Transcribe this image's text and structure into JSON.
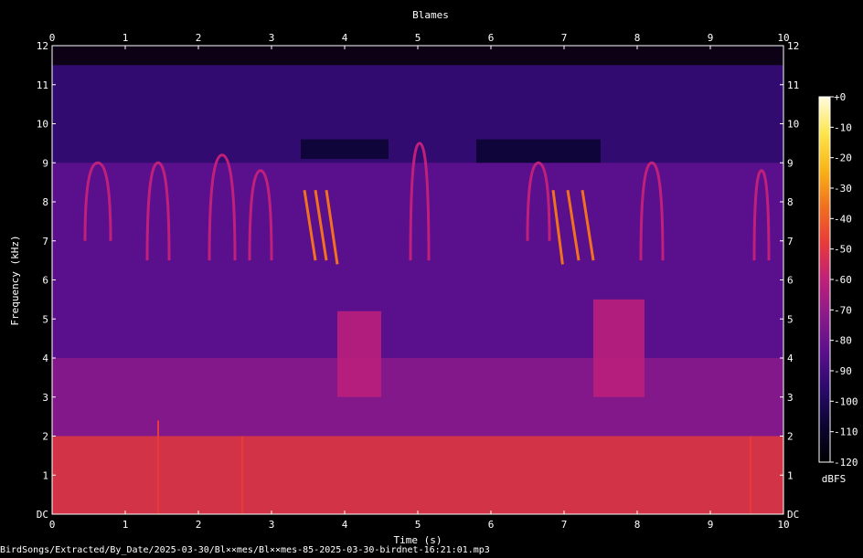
{
  "chart_data": {
    "type": "heatmap",
    "title": "Blames",
    "xlabel": "Time (s)",
    "ylabel": "Frequency (kHz)",
    "xlim": [
      0,
      10
    ],
    "ylim": [
      0,
      12
    ],
    "x_ticks": [
      "0",
      "1",
      "2",
      "3",
      "4",
      "5",
      "6",
      "7",
      "8",
      "9",
      "10"
    ],
    "y_ticks": [
      "DC",
      "1",
      "2",
      "3",
      "4",
      "5",
      "6",
      "7",
      "8",
      "9",
      "10",
      "11",
      "12"
    ],
    "colorbar": {
      "label": "dBFS",
      "range": [
        -120,
        0
      ],
      "ticks": [
        "+0",
        "-10",
        "-20",
        "-30",
        "-40",
        "-50",
        "-60",
        "-70",
        "-80",
        "-90",
        "-100",
        "-110",
        "-120"
      ],
      "colors": [
        "#000000",
        "#0b0530",
        "#2a0a6b",
        "#5a0f8c",
        "#8a1a8a",
        "#c0207a",
        "#e83a3a",
        "#f2701e",
        "#f9b417",
        "#fde64c",
        "#fffbe0"
      ]
    },
    "features": [
      {
        "type": "band",
        "t": [
          0.0,
          10.0
        ],
        "f": [
          0.0,
          2.0
        ],
        "db": -45
      },
      {
        "type": "band",
        "t": [
          0.0,
          10.0
        ],
        "f": [
          2.0,
          4.0
        ],
        "db": -70
      },
      {
        "type": "band",
        "t": [
          0.0,
          10.0
        ],
        "f": [
          4.0,
          9.0
        ],
        "db": -85
      },
      {
        "type": "band",
        "t": [
          0.0,
          10.0
        ],
        "f": [
          9.0,
          11.5
        ],
        "db": -95
      },
      {
        "type": "band",
        "t": [
          0.0,
          10.0
        ],
        "f": [
          11.5,
          12.0
        ],
        "db": -115
      },
      {
        "type": "band",
        "t": [
          3.4,
          4.6
        ],
        "f": [
          9.1,
          9.6
        ],
        "db": -112
      },
      {
        "type": "band",
        "t": [
          5.8,
          7.5
        ],
        "f": [
          9.0,
          9.6
        ],
        "db": -112
      },
      {
        "type": "band",
        "t": [
          3.9,
          4.5
        ],
        "f": [
          3.0,
          5.2
        ],
        "db": -62
      },
      {
        "type": "band",
        "t": [
          7.4,
          8.1
        ],
        "f": [
          3.0,
          5.5
        ],
        "db": -62
      },
      {
        "type": "stroke",
        "t": [
          3.45,
          3.6
        ],
        "f": [
          8.3,
          6.5
        ],
        "db": -35
      },
      {
        "type": "stroke",
        "t": [
          3.6,
          3.75
        ],
        "f": [
          8.3,
          6.5
        ],
        "db": -35
      },
      {
        "type": "stroke",
        "t": [
          3.75,
          3.9
        ],
        "f": [
          8.3,
          6.4
        ],
        "db": -35
      },
      {
        "type": "stroke",
        "t": [
          6.85,
          6.98
        ],
        "f": [
          8.3,
          6.4
        ],
        "db": -38
      },
      {
        "type": "stroke",
        "t": [
          7.05,
          7.2
        ],
        "f": [
          8.3,
          6.5
        ],
        "db": -38
      },
      {
        "type": "stroke",
        "t": [
          7.25,
          7.4
        ],
        "f": [
          8.3,
          6.5
        ],
        "db": -38
      },
      {
        "type": "arch",
        "t": [
          0.45,
          0.8
        ],
        "f": [
          7.0,
          9.0
        ],
        "db": -60
      },
      {
        "type": "arch",
        "t": [
          1.3,
          1.6
        ],
        "f": [
          6.5,
          9.0
        ],
        "db": -60
      },
      {
        "type": "arch",
        "t": [
          2.15,
          2.5
        ],
        "f": [
          6.5,
          9.2
        ],
        "db": -62
      },
      {
        "type": "arch",
        "t": [
          2.7,
          3.0
        ],
        "f": [
          6.5,
          8.8
        ],
        "db": -62
      },
      {
        "type": "arch",
        "t": [
          4.9,
          5.15
        ],
        "f": [
          6.5,
          9.5
        ],
        "db": -62
      },
      {
        "type": "arch",
        "t": [
          6.5,
          6.8
        ],
        "f": [
          7.0,
          9.0
        ],
        "db": -62
      },
      {
        "type": "arch",
        "t": [
          8.05,
          8.35
        ],
        "f": [
          6.5,
          9.0
        ],
        "db": -62
      },
      {
        "type": "arch",
        "t": [
          9.6,
          9.8
        ],
        "f": [
          6.5,
          8.8
        ],
        "db": -64
      },
      {
        "type": "vline",
        "t": [
          1.45,
          1.45
        ],
        "f": [
          0.0,
          2.4
        ],
        "db": -50
      },
      {
        "type": "vline",
        "t": [
          2.6,
          2.6
        ],
        "f": [
          0.0,
          2.0
        ],
        "db": -50
      },
      {
        "type": "vline",
        "t": [
          9.55,
          9.55
        ],
        "f": [
          0.0,
          2.0
        ],
        "db": -48
      }
    ]
  },
  "footer": {
    "path": "BirdSongs/Extracted/By_Date/2025-03-30/Bl××mes/Bl××mes-85-2025-03-30-birdnet-16:21:01.mp3"
  }
}
